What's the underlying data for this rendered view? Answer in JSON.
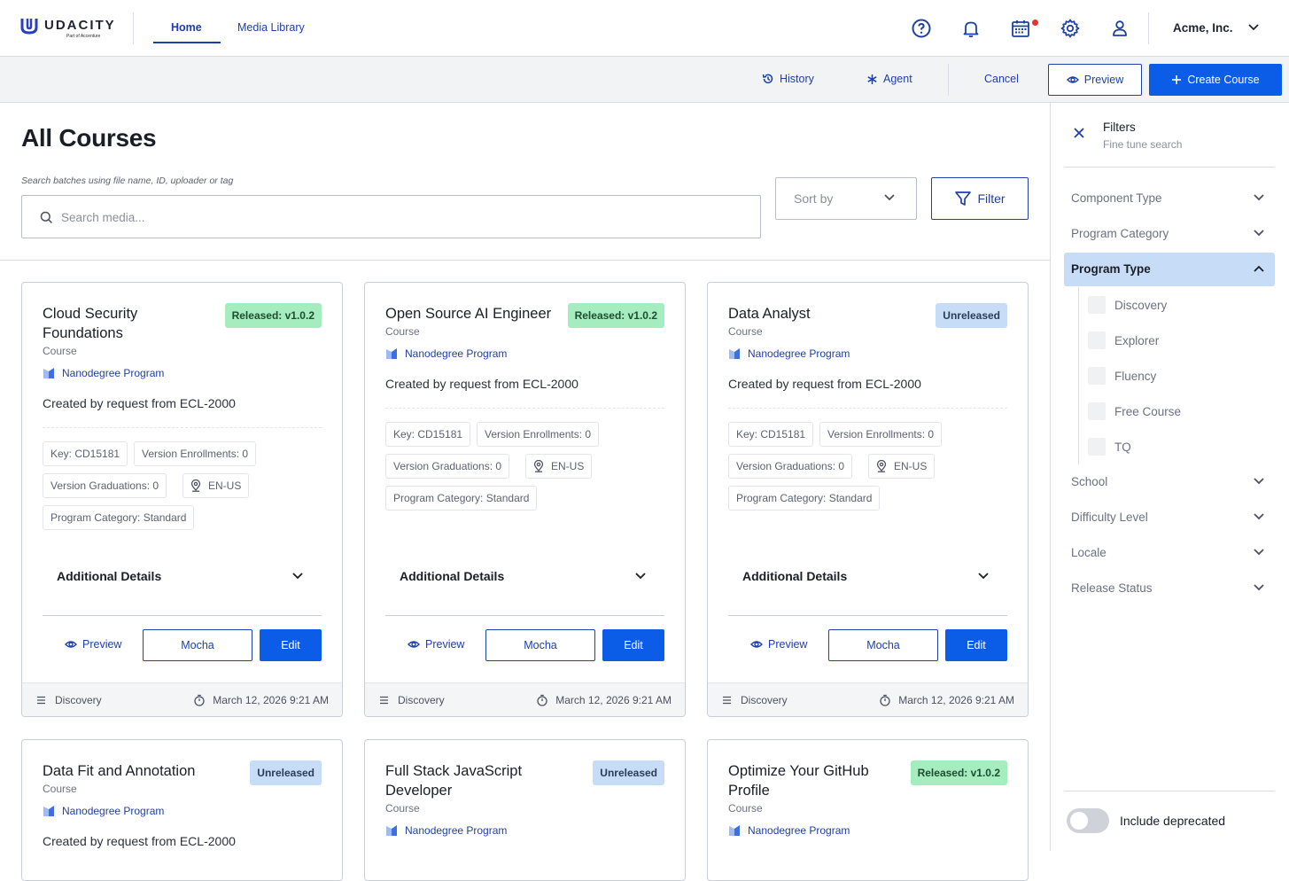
{
  "brand": {
    "name": "UDACITY",
    "tagline": "Part of Accenture"
  },
  "nav": {
    "tabs": [
      {
        "label": "Home",
        "active": true
      },
      {
        "label": "Media Library",
        "active": false
      }
    ],
    "icons": [
      "help-circle-icon",
      "bell-icon",
      "calendar-icon",
      "gear-icon",
      "user-icon"
    ],
    "account": "Acme, Inc."
  },
  "toolbar": {
    "history": "History",
    "agent": "Agent",
    "cancel": "Cancel",
    "preview": "Preview",
    "create": "Create Course"
  },
  "page": {
    "title": "All Courses",
    "search_label": "Search batches using file name, ID, uploader or tag",
    "search_placeholder": "Search media...",
    "sort_placeholder": "Sort by",
    "filter": "Filter"
  },
  "cards": [
    {
      "title": "Cloud Security Foundations",
      "type": "Course",
      "program": "Nanodegree Program",
      "badge": "Released: v1.0.2",
      "badge_kind": "released",
      "desc": "Created by request from ECL-2000",
      "key": "Key: CD15181",
      "enrollments": "Version Enrollments: 0",
      "graduations": "Version Graduations: 0",
      "locale": "EN-US",
      "category": "Program Category: Standard",
      "details": "Additional Details",
      "preview": "Preview",
      "mocha": "Mocha",
      "edit": "Edit",
      "footer_cat": "Discovery",
      "date": "March 12, 2026 9:21 AM"
    },
    {
      "title": "Open Source AI Engineer",
      "type": "Course",
      "program": "Nanodegree Program",
      "badge": "Released: v1.0.2",
      "badge_kind": "released",
      "desc": "Created by request from ECL-2000",
      "key": "Key: CD15181",
      "enrollments": "Version Enrollments: 0",
      "graduations": "Version Graduations: 0",
      "locale": "EN-US",
      "category": "Program Category: Standard",
      "details": "Additional Details",
      "preview": "Preview",
      "mocha": "Mocha",
      "edit": "Edit",
      "footer_cat": "Discovery",
      "date": "March 12, 2026 9:21 AM"
    },
    {
      "title": "Data Analyst",
      "type": "Course",
      "program": "Nanodegree Program",
      "badge": "Unreleased",
      "badge_kind": "unreleased",
      "desc": "Created by request from ECL-2000",
      "key": "Key: CD15181",
      "enrollments": "Version Enrollments: 0",
      "graduations": "Version Graduations: 0",
      "locale": "EN-US",
      "category": "Program Category: Standard",
      "details": "Additional Details",
      "preview": "Preview",
      "mocha": "Mocha",
      "edit": "Edit",
      "footer_cat": "Discovery",
      "date": "March 12, 2026 9:21 AM"
    },
    {
      "title": "Data Fit and Annotation",
      "type": "Course",
      "program": "Nanodegree Program",
      "badge": "Unreleased",
      "badge_kind": "unreleased",
      "desc": "Created by request from ECL-2000"
    },
    {
      "title": "Full Stack JavaScript Developer",
      "type": "Course",
      "program": "Nanodegree Program",
      "badge": "Unreleased",
      "badge_kind": "unreleased"
    },
    {
      "title": "Optimize Your GitHub Profile",
      "type": "Course",
      "program": "Nanodegree Program",
      "badge": "Released: v1.0.2",
      "badge_kind": "released"
    }
  ],
  "filters": {
    "title": "Filters",
    "subtitle": "Fine tune search",
    "groups": [
      "Component Type",
      "Program Category",
      "Program Type",
      "School",
      "Difficulty Level",
      "Locale",
      "Release Status"
    ],
    "open_group": "Program Type",
    "options": [
      "Discovery",
      "Explorer",
      "Fluency",
      "Free Course",
      "TQ"
    ],
    "deprecated_label": "Include deprecated",
    "deprecated_on": false
  },
  "colors": {
    "primary": "#0b5de8",
    "link": "#1e3fa8",
    "released_badge": "#a5ecbf",
    "unreleased_badge": "#c7ddf7",
    "notification_dot": "#e0362c"
  }
}
